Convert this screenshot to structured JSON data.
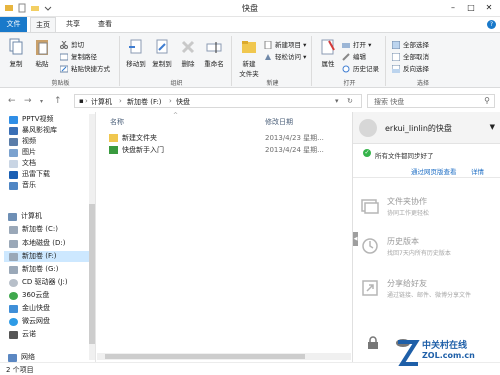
{
  "window": {
    "title": "快盘"
  },
  "tabs": [
    {
      "label": "文件"
    },
    {
      "label": "主页"
    },
    {
      "label": "共享"
    },
    {
      "label": "查看"
    }
  ],
  "ribbon": {
    "clipboard": {
      "label": "剪贴板",
      "copy": "复制",
      "paste": "粘贴",
      "cut": "剪切",
      "copy_path": "复制路径",
      "paste_shortcut": "粘贴快捷方式"
    },
    "organize": {
      "label": "组织",
      "move_to": "移动到",
      "copy_to": "复制到",
      "delete": "删除",
      "rename": "重命名"
    },
    "new": {
      "label": "新建",
      "new_folder": "新建\n文件夹",
      "new_item": "新建项目",
      "easy_access": "轻松访问"
    },
    "open": {
      "label": "打开",
      "properties": "属性",
      "open": "打开",
      "edit": "编辑",
      "history": "历史记录"
    },
    "select": {
      "label": "选择",
      "select_all": "全部选择",
      "select_none": "全部取消",
      "invert": "反向选择"
    }
  },
  "address": {
    "crumbs": [
      "计算机",
      "新加卷 (F:)",
      "快盘"
    ],
    "search_placeholder": "搜索 快盘"
  },
  "nav": {
    "items": [
      {
        "label": "PPTV视频"
      },
      {
        "label": "暴风影视库"
      },
      {
        "label": "视频"
      },
      {
        "label": "图片"
      },
      {
        "label": "文档"
      },
      {
        "label": "迅雷下载"
      },
      {
        "label": "音乐"
      },
      {
        "label": "计算机"
      },
      {
        "label": "新加卷 (C:)"
      },
      {
        "label": "本地磁盘 (D:)"
      },
      {
        "label": "新加卷 (F:)"
      },
      {
        "label": "新加卷 (G:)"
      },
      {
        "label": "CD 驱动器 (J:)"
      },
      {
        "label": "360云盘"
      },
      {
        "label": "金山快盘"
      },
      {
        "label": "微云网盘"
      },
      {
        "label": "云诺"
      },
      {
        "label": "网络"
      }
    ]
  },
  "filelist": {
    "col_name": "名称",
    "col_date": "修改日期",
    "rows": [
      {
        "name": "新建文件夹",
        "date": "2013/4/23 星期..."
      },
      {
        "name": "快盘新手入门",
        "date": "2013/4/24 星期..."
      }
    ]
  },
  "panel": {
    "username": "erkui_linlin的快盘",
    "status": "所有文件都同步好了",
    "link_web": "通过网页版查看",
    "link_detail": "详情",
    "features": [
      {
        "title": "文件夹协作",
        "desc": "协同工作更轻松"
      },
      {
        "title": "历史版本",
        "desc": "找回7天内所有历史版本"
      },
      {
        "title": "分享给好友",
        "desc": "通过链接、邮件、微博分享文件"
      }
    ]
  },
  "status": {
    "count": "2 个项目"
  },
  "watermark": {
    "brand": "中关村在线",
    "site": "ZOL.com.cn"
  },
  "colors": {
    "accent": "#1979ca",
    "selection": "#cde8ff",
    "ok": "#35b34a",
    "link": "#1f6fc5"
  }
}
